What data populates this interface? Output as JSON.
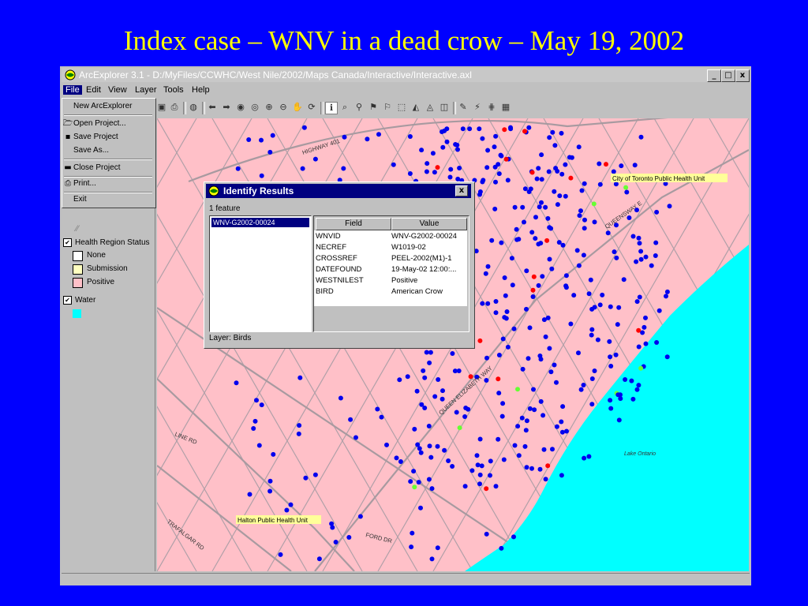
{
  "slide": {
    "title": "Index case – WNV in a dead crow – May 19, 2002"
  },
  "window": {
    "title": "ArcExplorer 3.1 - D:/MyFiles/CCWHC/West Nile/2002/Maps Canada/Interactive/Interactive.axl",
    "buttons": {
      "minimize": "_",
      "maximize": "□",
      "close": "x"
    }
  },
  "menubar": {
    "items": [
      {
        "label": "File",
        "active": true
      },
      {
        "label": "Edit"
      },
      {
        "label": "View"
      },
      {
        "label": "Layer"
      },
      {
        "label": "Tools"
      },
      {
        "label": "Help"
      }
    ]
  },
  "file_menu": {
    "items": [
      {
        "label": "New ArcExplorer",
        "icon": ""
      },
      {
        "label": "Open Project...",
        "icon": "folder-icon"
      },
      {
        "label": "Save Project",
        "icon": "disk-icon"
      },
      {
        "label": "Save As...",
        "icon": ""
      },
      {
        "label": "Close Project",
        "icon": "close-project-icon"
      },
      {
        "label": "Print...",
        "icon": "printer-icon"
      },
      {
        "label": "Exit",
        "icon": ""
      }
    ]
  },
  "legend": {
    "layers": [
      {
        "label": "Health Region Status",
        "checked": true,
        "classes": [
          {
            "label": "None",
            "color": "#ffffff"
          },
          {
            "label": "Submission",
            "color": "#ffffc0"
          },
          {
            "label": "Positive",
            "color": "#ffc0c8"
          }
        ]
      },
      {
        "label": "Water",
        "checked": true,
        "classes": [
          {
            "label": "",
            "color": "#00ffff"
          }
        ]
      }
    ]
  },
  "map": {
    "colors": {
      "land": "#ffc0c8",
      "water": "#00ffff",
      "roads": "#b0a0a8",
      "dot_blue": "#0000ee",
      "dot_red": "#ff0000",
      "dot_green": "#66ff33"
    },
    "road_labels": [
      "HIGHWAY 401",
      "QUEENSWAY E",
      "QUEEN ELIZABETH WAY",
      "LINE RD",
      "TRAFALGAR RD",
      "FORD DR"
    ],
    "place_labels": [
      "City of Toronto Public Health Unit",
      "Halton Public Health Unit"
    ],
    "water_label": "Lake Ontario"
  },
  "identify_dialog": {
    "title": "Identify Results",
    "close": "x",
    "feature_count": "1 feature",
    "selected_feature": "WNV-G2002-00024",
    "headers": {
      "field": "Field",
      "value": "Value"
    },
    "rows": [
      {
        "field": "WNVID",
        "value": "WNV-G2002-00024"
      },
      {
        "field": "NECREF",
        "value": "W1019-02"
      },
      {
        "field": "CROSSREF",
        "value": "PEEL-2002(M1)-1"
      },
      {
        "field": "DATEFOUND",
        "value": "19-May-02 12:00:..."
      },
      {
        "field": "WESTNILEST",
        "value": "Positive"
      },
      {
        "field": "BIRD",
        "value": "American Crow"
      }
    ],
    "layer_label": "Layer: Birds"
  }
}
